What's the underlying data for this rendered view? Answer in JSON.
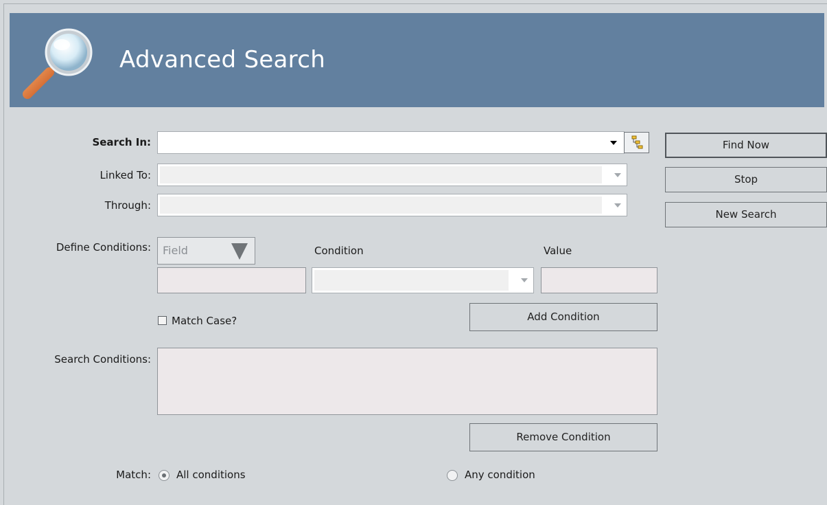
{
  "header": {
    "title": "Advanced Search"
  },
  "form": {
    "search_in_label": "Search In:",
    "linked_to_label": "Linked To:",
    "through_label": "Through:",
    "define_conditions_label": "Define Conditions:",
    "field_placeholder": "Field",
    "condition_header": "Condition",
    "value_header": "Value",
    "match_case_label": "Match Case?",
    "search_conditions_label": "Search Conditions:",
    "match_label": "Match:",
    "all_conditions_label": "All conditions",
    "any_condition_label": "Any condition"
  },
  "buttons": {
    "find_now": "Find Now",
    "stop": "Stop",
    "new_search": "New Search",
    "add_condition": "Add Condition",
    "remove_condition": "Remove Condition"
  },
  "icons": {
    "header_icon": "magnifier-icon",
    "browse_icon": "tree-browse-icon"
  },
  "colors": {
    "banner": "#62809f",
    "background": "#d4d8db"
  }
}
